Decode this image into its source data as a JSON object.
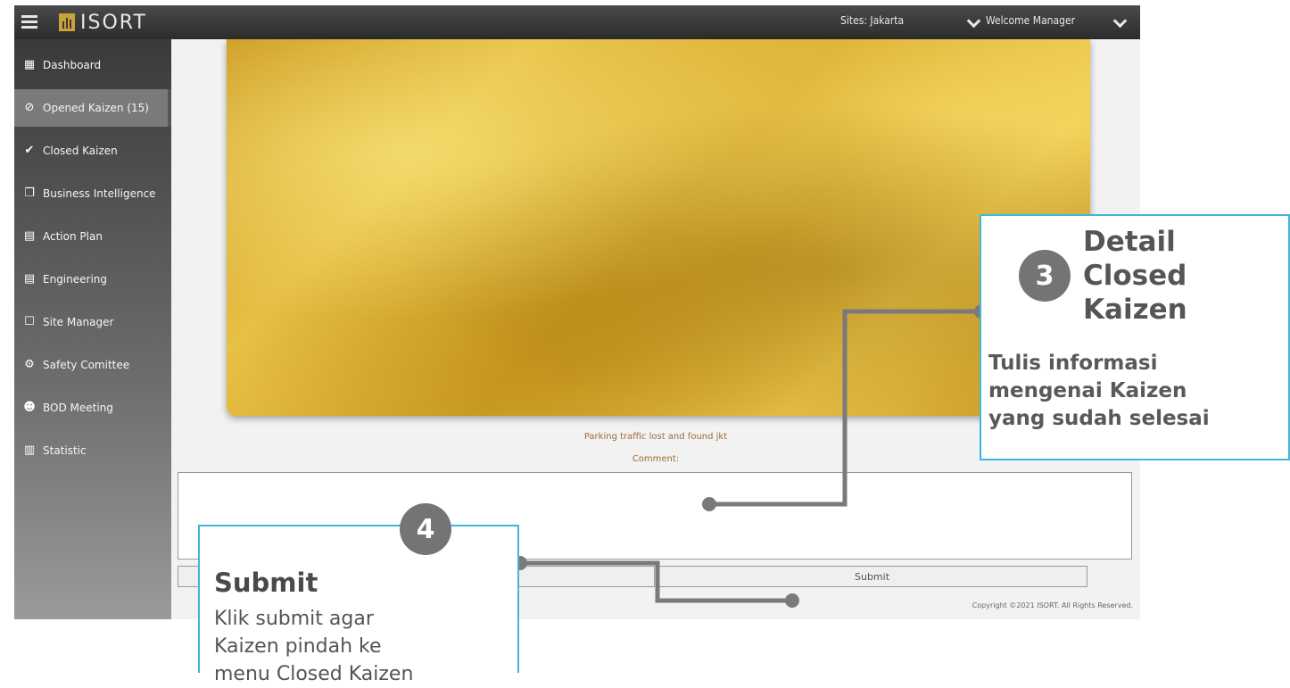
{
  "app": {
    "logo_text": "ISORT"
  },
  "topbar": {
    "site_label": "Sites: Jakarta",
    "user_label": "Welcome Manager"
  },
  "sidebar": {
    "items": [
      {
        "label": "Dashboard",
        "icon": "grid-icon"
      },
      {
        "label": "Opened Kaizen (15)",
        "icon": "compass-icon"
      },
      {
        "label": "Closed Kaizen",
        "icon": "check-circle-icon"
      },
      {
        "label": "Business Intelligence",
        "icon": "copy-icon"
      },
      {
        "label": "Action Plan",
        "icon": "calendar-icon"
      },
      {
        "label": "Engineering",
        "icon": "calendar-icon"
      },
      {
        "label": "Site Manager",
        "icon": "square-icon"
      },
      {
        "label": "Safety Comittee",
        "icon": "gear-icon"
      },
      {
        "label": "BOD Meeting",
        "icon": "users-icon"
      },
      {
        "label": "Statistic",
        "icon": "bar-chart-icon"
      }
    ]
  },
  "main": {
    "caption": "Parking traffic lost and found jkt",
    "comment_label": "Comment:",
    "comment_value": "",
    "submit_label": "Submit",
    "copyright_prefix": "Copyright ©2021",
    "copyright_brand": "ISORT",
    "copyright_suffix": ". All Rights Reserved."
  },
  "callouts": {
    "step3": {
      "number": "3",
      "title_lines": [
        "Detail",
        "Closed",
        "Kaizen"
      ],
      "desc_lines": [
        "Tulis informasi",
        "mengenai Kaizen",
        "yang sudah selesai"
      ]
    },
    "step4": {
      "number": "4",
      "title": "Submit",
      "desc_lines": [
        "Klik submit agar",
        "Kaizen pindah ke",
        "menu Closed Kaizen"
      ]
    }
  },
  "colors": {
    "accent_border": "#3fb7d9",
    "badge": "#747474",
    "gold": "#d4a626"
  }
}
